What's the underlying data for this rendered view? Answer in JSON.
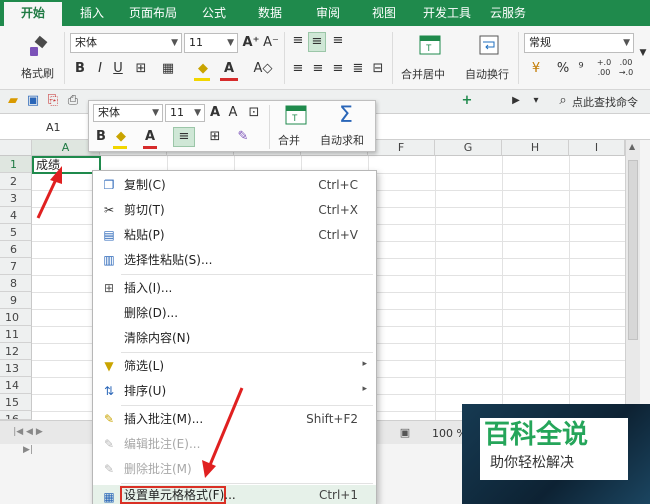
{
  "menu_tabs": [
    "开始",
    "插入",
    "页面布局",
    "公式",
    "数据",
    "审阅",
    "视图",
    "开发工具",
    "云服务"
  ],
  "ribbon": {
    "format_painter": "格式刷",
    "font_name": "宋体",
    "font_size": "11",
    "merge_center": "合并居中",
    "wrap_text": "自动换行",
    "number_format": "常规",
    "bold": "B",
    "italic": "I",
    "underline": "U",
    "grow_font": "A⁺",
    "shrink_font": "A⁻",
    "font_color": "A",
    "percent": "%",
    "comma": "⁹",
    "inc_decimal": "+.0 .00",
    "dec_decimal": ".00 →.0"
  },
  "quickbar": {
    "search_label": "点此查找命令"
  },
  "formula_bar": {
    "cell_ref": "A1"
  },
  "grid": {
    "columns": [
      "A",
      "B",
      "C",
      "D",
      "E",
      "F",
      "G",
      "H",
      "I"
    ],
    "rows": [
      "1",
      "2",
      "3",
      "4",
      "5",
      "6",
      "7",
      "8",
      "9",
      "10",
      "11",
      "12",
      "13",
      "14",
      "15",
      "16"
    ],
    "a1_value": "成绩"
  },
  "mini_toolbar": {
    "font_name": "宋体",
    "font_size": "11",
    "merge": "合并",
    "autosum": "自动求和"
  },
  "context_menu": [
    {
      "label": "复制(C)",
      "shortcut": "Ctrl+C",
      "icon": "copy-icon"
    },
    {
      "label": "剪切(T)",
      "shortcut": "Ctrl+X",
      "icon": "scissors-icon"
    },
    {
      "label": "粘贴(P)",
      "shortcut": "Ctrl+V",
      "icon": "paste-icon"
    },
    {
      "label": "选择性粘贴(S)...",
      "shortcut": "",
      "icon": "paste-special-icon"
    },
    {
      "label": "插入(I)...",
      "shortcut": "",
      "icon": "insert-icon"
    },
    {
      "label": "删除(D)...",
      "shortcut": "",
      "icon": ""
    },
    {
      "label": "清除内容(N)",
      "shortcut": "",
      "icon": ""
    },
    {
      "label": "筛选(L)",
      "shortcut": "",
      "icon": "filter-icon"
    },
    {
      "label": "排序(U)",
      "shortcut": "",
      "icon": "sort-icon"
    },
    {
      "label": "插入批注(M)...",
      "shortcut": "Shift+F2",
      "icon": "comment-icon"
    },
    {
      "label": "编辑批注(E)...",
      "shortcut": "",
      "icon": "edit-comment-icon"
    },
    {
      "label": "删除批注(M)",
      "shortcut": "",
      "icon": "delete-comment-icon"
    },
    {
      "label": "设置单元格格式(F)...",
      "shortcut": "Ctrl+1",
      "icon": "format-cells-icon"
    }
  ],
  "status": {
    "zoom": "100 %"
  },
  "watermark": {
    "title": "百科全说",
    "subtitle": "助你轻松解决"
  },
  "colors": {
    "accent": "#1f8a4c",
    "highlight": "#d93025"
  }
}
